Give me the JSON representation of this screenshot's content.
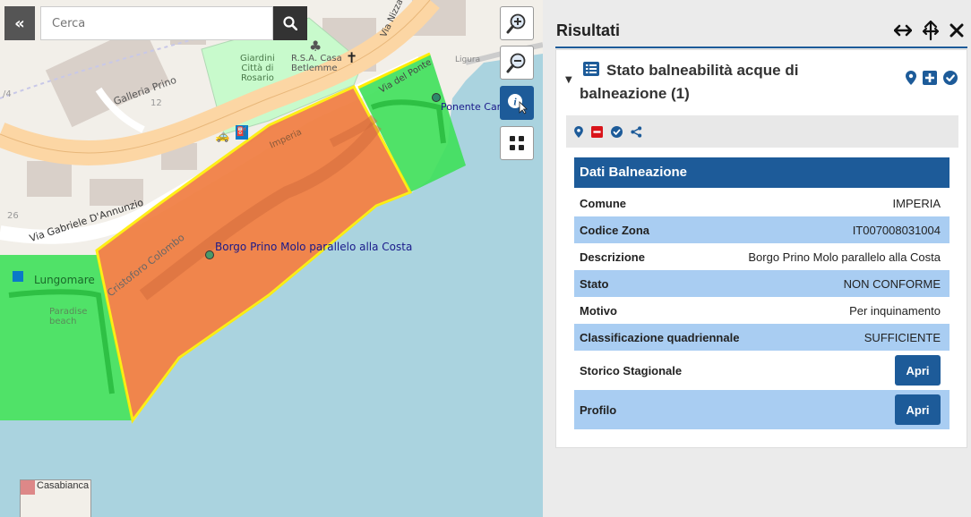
{
  "search": {
    "placeholder": "Cerca"
  },
  "map": {
    "labels": {
      "via_gabriele": "Via Gabriele D'Annunzio",
      "cristoforo": "Cristoforo Colombo",
      "galleria": "Galleria Prino",
      "giardini": "Giardini\nCittà di\nRosario",
      "rsa": "R.S.A. Casa\nBetlemme",
      "via_del_ponte": "Via del Ponte",
      "via_nizza": "Via Nizza",
      "ponente": "Ponente Car",
      "ligura": "Ligura",
      "lungomare": "Lungomare",
      "paradise": "Paradise\nbeach",
      "imperia_road": "Imperia",
      "borgo": "Borgo Prino Molo parallelo alla Costa",
      "num_12": "12",
      "num_26": "26",
      "num_4": "/4",
      "minimap": "Casabianca"
    },
    "colors": {
      "poly_red": "#f07a3c",
      "poly_green": "#3ee05a",
      "border": "#ffee00",
      "sea": "#aad3df"
    }
  },
  "panel": {
    "title": "Risultati",
    "layer_name": "Stato balneabilità acque di balneazione (1)",
    "section_title": "Dati Balneazione",
    "rows": [
      {
        "key": "Comune",
        "value": "IMPERIA"
      },
      {
        "key": "Codice Zona",
        "value": "IT007008031004"
      },
      {
        "key": "Descrizione",
        "value": "Borgo Prino Molo parallelo alla Costa"
      },
      {
        "key": "Stato",
        "value": "NON CONFORME"
      },
      {
        "key": "Motivo",
        "value": "Per inquinamento"
      },
      {
        "key": "Classificazione quadriennale",
        "value": "SUFFICIENTE"
      }
    ],
    "button_rows": [
      {
        "key": "Storico Stagionale",
        "button": "Apri"
      },
      {
        "key": "Profilo",
        "button": "Apri"
      }
    ],
    "accent": "#1d5b99",
    "alt_row": "#a9cdf2"
  }
}
